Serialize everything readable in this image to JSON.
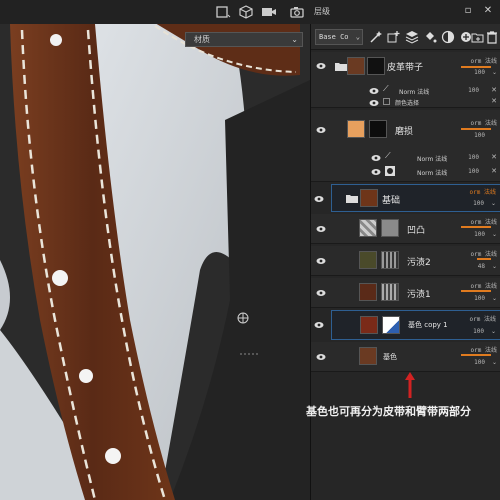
{
  "topbar": {
    "panel_title": "层级",
    "icons": [
      "2d-view-icon",
      "3d-cube-icon",
      "camera-video-icon",
      "screenshot-camera-icon"
    ],
    "window_buttons": [
      "pin-icon",
      "close-icon"
    ]
  },
  "viewport": {
    "material_select": "材质"
  },
  "toolbar": {
    "blend_value": "Base Co",
    "icons": [
      "wand-icon",
      "layer-add-icon",
      "stack-icon",
      "fill-icon",
      "mask-icon",
      "effect-icon",
      "folder-add-icon",
      "trash-icon"
    ]
  },
  "layers": [
    {
      "name": "皮革带子",
      "blend": "orm 法线",
      "opacity": "100",
      "type": "group"
    },
    {
      "name": "Norm 法线",
      "opacity": "100",
      "type": "fx-brush"
    },
    {
      "name": "颜色选择",
      "type": "fx-check"
    },
    {
      "name": "磨损",
      "blend": "orm 法线",
      "opacity": "100",
      "type": "layer"
    },
    {
      "name": "Norm 法线",
      "opacity": "100",
      "type": "fx-brush"
    },
    {
      "name": "Norm 法线",
      "opacity": "100",
      "type": "fx-circle"
    },
    {
      "name": "基础",
      "blend": "orm 法线",
      "opacity": "100",
      "type": "group"
    },
    {
      "name": "凹凸",
      "blend": "orm 法线",
      "opacity": "100",
      "type": "layer"
    },
    {
      "name": "污渍2",
      "blend": "orm 法线",
      "opacity": "48",
      "type": "layer"
    },
    {
      "name": "污渍1",
      "blend": "orm 法线",
      "opacity": "100",
      "type": "layer"
    },
    {
      "name": "基色 copy 1",
      "blend": "orm 法线",
      "opacity": "100",
      "type": "layer"
    },
    {
      "name": "基色",
      "blend": "orm 法线",
      "opacity": "100",
      "type": "layer"
    }
  ],
  "annotation": "基色也可再分为皮带和臂带两部分",
  "colors": {
    "accent": "#e07b1f",
    "selection": "#2e5f92",
    "annotation_arrow": "#d22222"
  }
}
